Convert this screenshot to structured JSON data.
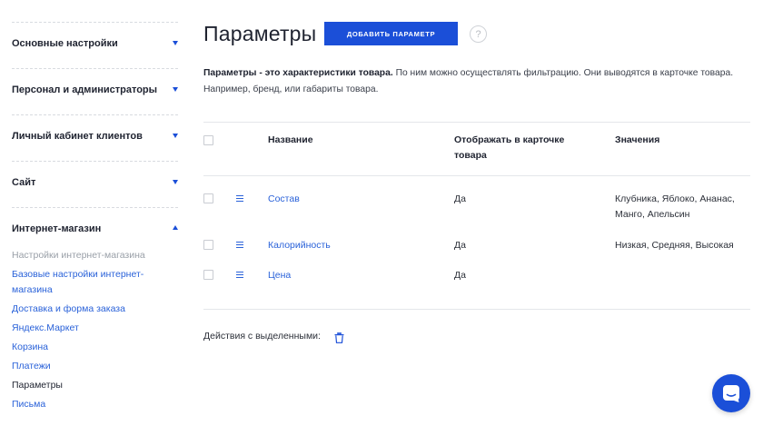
{
  "sidebar": {
    "sections": [
      {
        "title": "Основные настройки",
        "expanded": false
      },
      {
        "title": "Персонал и администраторы",
        "expanded": false
      },
      {
        "title": "Личный кабинет клиентов",
        "expanded": false
      },
      {
        "title": "Сайт",
        "expanded": false
      },
      {
        "title": "Интернет-магазин",
        "expanded": true
      }
    ],
    "shop_items": [
      {
        "label": "Настройки интернет-магазина",
        "state": "muted"
      },
      {
        "label": "Базовые настройки интернет-магазина",
        "state": "link"
      },
      {
        "label": "Доставка и форма заказа",
        "state": "link"
      },
      {
        "label": "Яндекс.Маркет",
        "state": "link"
      },
      {
        "label": "Корзина",
        "state": "link"
      },
      {
        "label": "Платежи",
        "state": "link"
      },
      {
        "label": "Параметры",
        "state": "active"
      },
      {
        "label": "Письма",
        "state": "link"
      }
    ]
  },
  "header": {
    "title": "Параметры",
    "add_button_label": "ДОБАВИТЬ ПАРАМЕТР",
    "help_glyph": "?"
  },
  "description": {
    "bold": "Параметры - это характеристики товара.",
    "text": " По ним можно осуществлять фильтрацию. Они выводятся в карточке товара. Например, бренд, или габариты товара."
  },
  "table": {
    "columns": [
      "Название",
      "Отображать в карточке товара",
      "Значения"
    ],
    "rows": [
      {
        "name": "Состав",
        "show": "Да",
        "values": "Клубника, Яблоко, Ананас, Манго, Апельсин"
      },
      {
        "name": "Калорийность",
        "show": "Да",
        "values": "Низкая, Средняя, Высокая"
      },
      {
        "name": "Цена",
        "show": "Да",
        "values": ""
      }
    ]
  },
  "footer": {
    "actions_label": "Действия с выделенными:"
  },
  "colors": {
    "accent": "#1b4fd8",
    "link": "#2a62d9"
  },
  "icons": {
    "section_toggle": "triangle-icon",
    "help": "question-icon",
    "drag": "drag-handle-icon",
    "delete": "trash-icon",
    "chat": "chat-icon"
  }
}
